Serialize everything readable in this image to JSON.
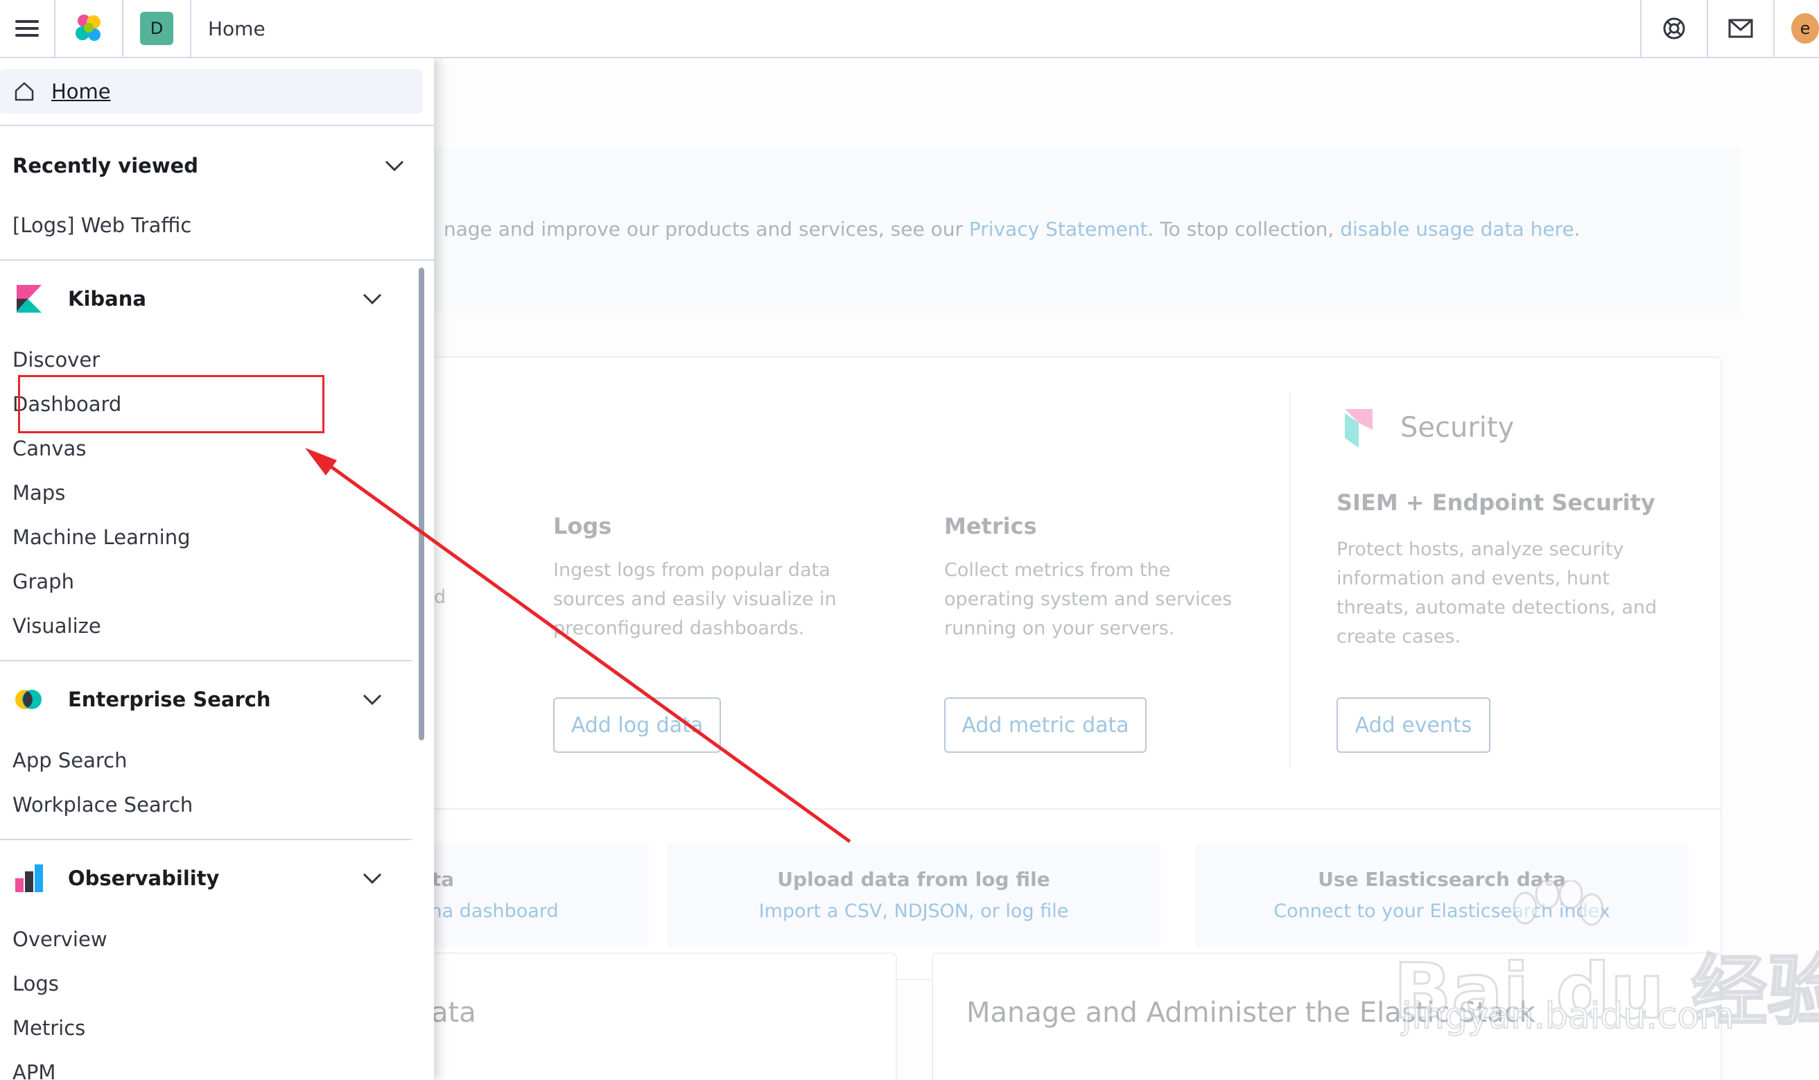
{
  "header": {
    "breadcrumb": "Home",
    "space_initial": "D",
    "user_initial": "e"
  },
  "background": {
    "notice_prefix": "nage and improve our products and services, see our ",
    "notice_link1": "Privacy Statement",
    "notice_middle": ". To stop collection, ",
    "notice_link2": "disable usage data here",
    "notice_suffix": ".",
    "security_title": "Security",
    "security_subtitle": "SIEM + Endpoint Security",
    "logs": {
      "title": "Logs",
      "desc": "Ingest logs from popular data sources and easily visualize in preconfigured dashboards.",
      "button": "Add log data"
    },
    "metrics": {
      "title": "Metrics",
      "desc": "Collect metrics from the operating system and services running on your servers.",
      "button": "Add metric data"
    },
    "security": {
      "desc": "Protect hosts, analyze security information and events, hunt threats, automate detections, and create cases.",
      "button": "Add events"
    },
    "partial_letter": "d",
    "sample_card": {
      "title": "ata",
      "sub": "ana dashboard"
    },
    "upload_card": {
      "title": "Upload data from log file",
      "sub": "Import a CSV, NDJSON, or log file"
    },
    "es_card": {
      "title": "Use Elasticsearch data",
      "sub": "Connect to your Elasticsearch index"
    },
    "bottom_left_title": "ata",
    "bottom_right_title": "Manage and Administer the Elastic Stack"
  },
  "nav": {
    "home": "Home",
    "recently_viewed": {
      "label": "Recently viewed",
      "items": [
        "[Logs] Web Traffic"
      ]
    },
    "kibana": {
      "label": "Kibana",
      "items": [
        "Discover",
        "Dashboard",
        "Canvas",
        "Maps",
        "Machine Learning",
        "Graph",
        "Visualize"
      ]
    },
    "enterprise_search": {
      "label": "Enterprise Search",
      "items": [
        "App Search",
        "Workplace Search"
      ]
    },
    "observability": {
      "label": "Observability",
      "items": [
        "Overview",
        "Logs",
        "Metrics",
        "APM"
      ]
    }
  },
  "watermark": {
    "text": "Bai du 经验",
    "url": "jingyan.baidu.com"
  },
  "colors": {
    "accent": "#006bb8",
    "annotation": "#e8262b",
    "space_avatar": "#54b399",
    "user_avatar": "#e7a25e"
  }
}
